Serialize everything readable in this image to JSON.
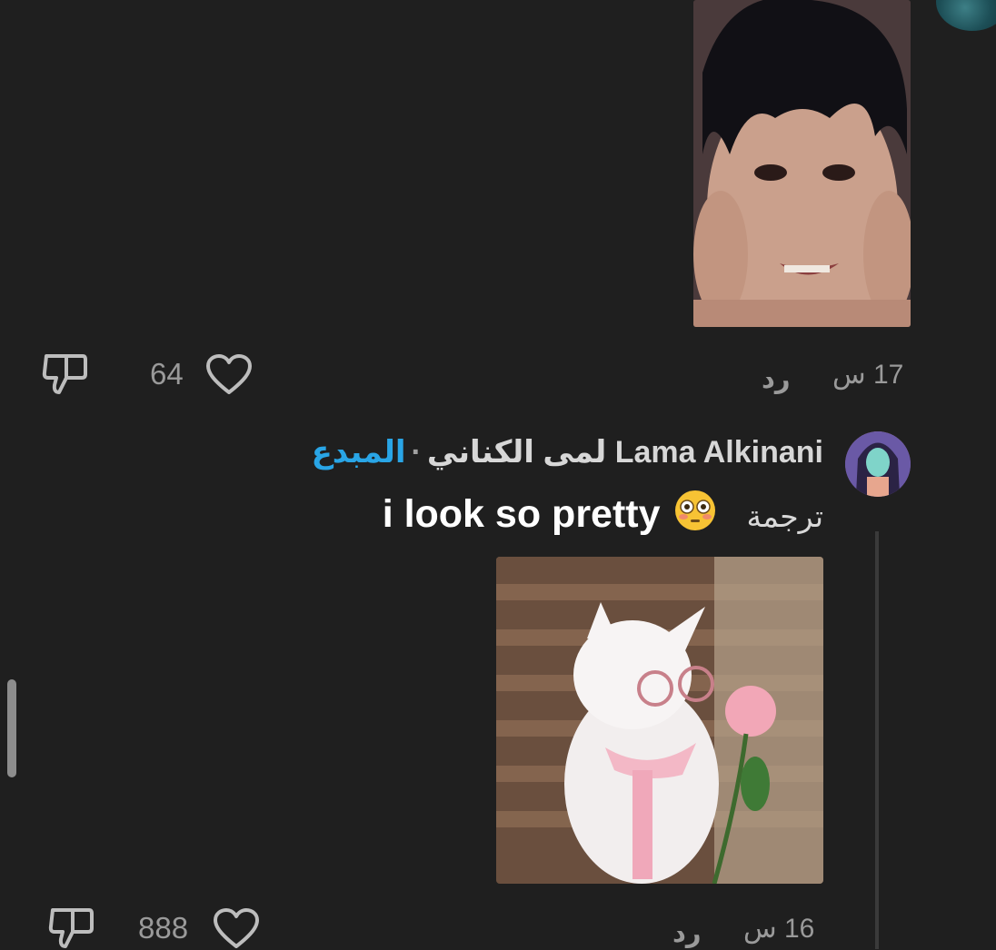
{
  "comments": [
    {
      "likes": "64",
      "reply_label": "رد",
      "time": "17 س"
    },
    {
      "author": "Lama Alkinani لمى الكناني",
      "separator": "·",
      "badge": "المبدع",
      "translate_label": "ترجمة",
      "text": "i look so pretty",
      "emoji": "flushed-face-emoji",
      "likes": "888",
      "reply_label": "رد",
      "time": "16 س"
    }
  ],
  "colors": {
    "background": "#1f1f1f",
    "muted_text": "#9a9a9a",
    "creator_badge": "#29a5e6",
    "primary_text": "#ffffff"
  },
  "icons": [
    "dislike-icon",
    "heart-icon"
  ]
}
